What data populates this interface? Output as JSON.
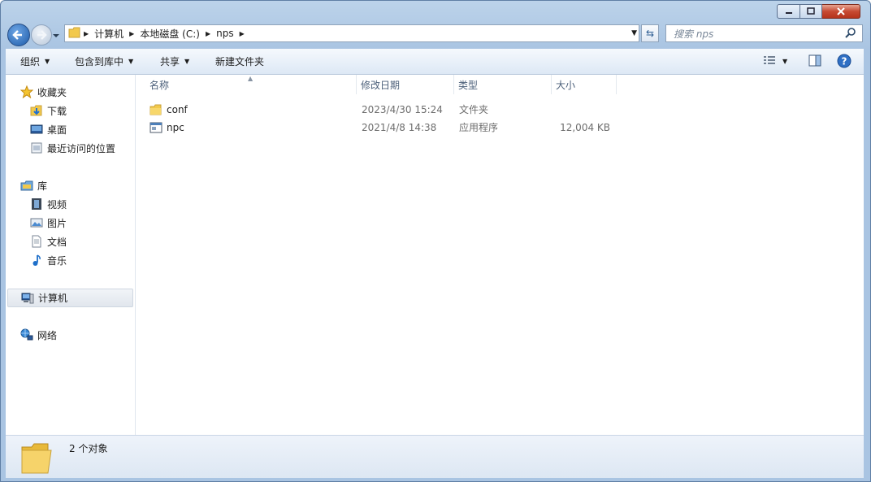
{
  "window": {
    "controls": {
      "minimize": "minimize-icon",
      "maximize": "maximize-icon",
      "close": "close-icon"
    }
  },
  "address_bar": {
    "breadcrumbs": [
      "计算机",
      "本地磁盘 (C:)",
      "nps"
    ]
  },
  "search": {
    "placeholder": "搜索 nps"
  },
  "toolbar": {
    "organize": "组织",
    "include_in_library": "包含到库中",
    "share": "共享",
    "new_folder": "新建文件夹"
  },
  "sidebar": {
    "favorites": {
      "label": "收藏夹",
      "items": [
        "下载",
        "桌面",
        "最近访问的位置"
      ]
    },
    "libraries": {
      "label": "库",
      "items": [
        "视频",
        "图片",
        "文档",
        "音乐"
      ]
    },
    "computer": "计算机",
    "network": "网络"
  },
  "columns": [
    "名称",
    "修改日期",
    "类型",
    "大小"
  ],
  "files": [
    {
      "name": "conf",
      "modified": "2023/4/30 15:24",
      "type": "文件夹",
      "size": "",
      "icon": "folder-icon"
    },
    {
      "name": "npc",
      "modified": "2021/4/8 14:38",
      "type": "应用程序",
      "size": "12,004 KB",
      "icon": "exe-icon"
    }
  ],
  "details": {
    "count": "2 个对象"
  },
  "colors": {
    "selection": "#e1e6ed",
    "accent": "#1c5aa8",
    "header_text": "#4c607a"
  }
}
